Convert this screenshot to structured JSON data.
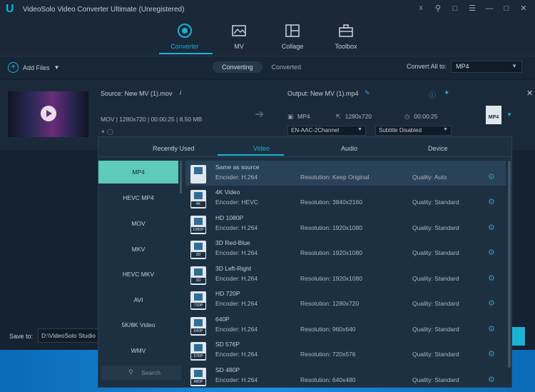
{
  "app": {
    "logo_letter": "U",
    "title": "VideoSolo Video Converter Ultimate (Unregistered)"
  },
  "titlebar_icons": [
    "cart-icon",
    "key-icon",
    "feedback-icon",
    "menu-icon",
    "minimize-icon",
    "maximize-icon",
    "close-icon"
  ],
  "nav": [
    {
      "label": "Converter",
      "icon": "converter-icon",
      "active": true
    },
    {
      "label": "MV",
      "icon": "mv-icon",
      "active": false
    },
    {
      "label": "Collage",
      "icon": "collage-icon",
      "active": false
    },
    {
      "label": "Toolbox",
      "icon": "toolbox-icon",
      "active": false
    }
  ],
  "toolbar": {
    "add_files": "Add Files",
    "tabs": [
      "Converting",
      "Converted"
    ],
    "active_tab": "Converting",
    "convert_all_label": "Convert All to:",
    "convert_all_value": "MP4"
  },
  "file": {
    "source": "Source: New MV (1).mov",
    "meta": "MOV | 1280x720 | 00:00:25 | 8.50 MB",
    "output": "Output: New MV (1).mp4",
    "out_format": "MP4",
    "out_resolution": "1280x720",
    "out_duration": "00:00:25",
    "audio": "EN-AAC-2Channel",
    "subtitle": "Subtitle Disabled",
    "format_badge": "MP4"
  },
  "bottom": {
    "save_to_label": "Save to:",
    "save_path": "D:\\VideoSolo Studio"
  },
  "popup": {
    "tabs": [
      "Recently Used",
      "Video",
      "Audio",
      "Device"
    ],
    "active_tab": "Video",
    "formats": [
      "MP4",
      "HEVC MP4",
      "MOV",
      "MKV",
      "HEVC MKV",
      "AVI",
      "5K/8K Video",
      "WMV"
    ],
    "active_format": "MP4",
    "search_placeholder": "Search",
    "presets": [
      {
        "name": "Same as source",
        "encoder": "Encoder: H.264",
        "resolution": "Resolution: Keep Original",
        "quality": "Quality: Auto",
        "badge": ""
      },
      {
        "name": "4K Video",
        "encoder": "Encoder: HEVC",
        "resolution": "Resolution: 3840x2160",
        "quality": "Quality: Standard",
        "badge": "4K"
      },
      {
        "name": "HD 1080P",
        "encoder": "Encoder: H.264",
        "resolution": "Resolution: 1920x1080",
        "quality": "Quality: Standard",
        "badge": "1080P"
      },
      {
        "name": "3D Red-Blue",
        "encoder": "Encoder: H.264",
        "resolution": "Resolution: 1920x1080",
        "quality": "Quality: Standard",
        "badge": "3D"
      },
      {
        "name": "3D Left-Right",
        "encoder": "Encoder: H.264",
        "resolution": "Resolution: 1920x1080",
        "quality": "Quality: Standard",
        "badge": "3D"
      },
      {
        "name": "HD 720P",
        "encoder": "Encoder: H.264",
        "resolution": "Resolution: 1280x720",
        "quality": "Quality: Standard",
        "badge": "720P"
      },
      {
        "name": "640P",
        "encoder": "Encoder: H.264",
        "resolution": "Resolution: 960x640",
        "quality": "Quality: Standard",
        "badge": "640P"
      },
      {
        "name": "SD 576P",
        "encoder": "Encoder: H.264",
        "resolution": "Resolution: 720x576",
        "quality": "Quality: Standard",
        "badge": "576P"
      },
      {
        "name": "SD 480P",
        "encoder": "Encoder: H.264",
        "resolution": "Resolution: 640x480",
        "quality": "Quality: Standard",
        "badge": "480P"
      }
    ]
  }
}
